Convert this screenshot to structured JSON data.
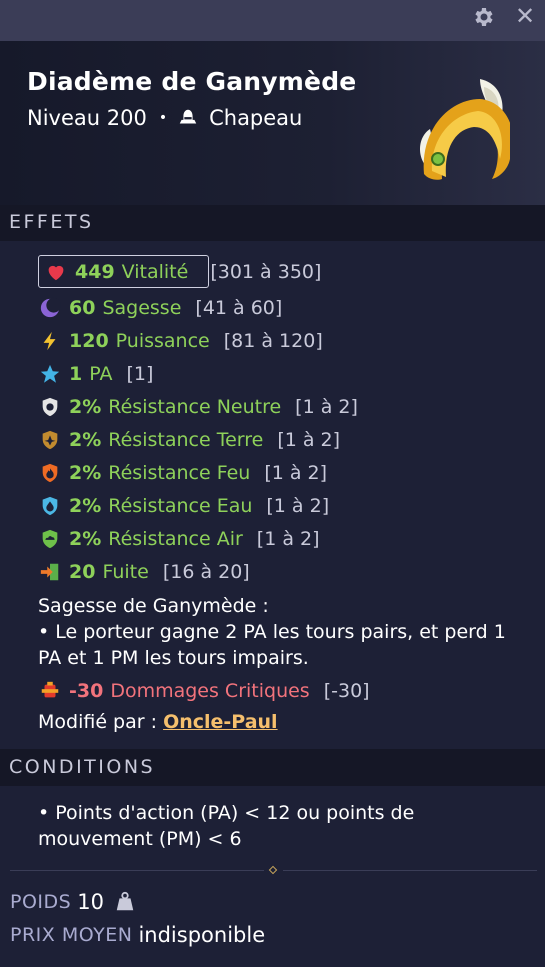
{
  "window": {
    "settings_icon": "gear-icon",
    "close_icon": "close-icon",
    "close_glyph": "✕"
  },
  "item": {
    "name": "Diadème de Ganymède",
    "level": "Niveau 200",
    "separator": "•",
    "type": "Chapeau",
    "type_icon": "hat-icon",
    "image": "tiara-icon"
  },
  "sections": {
    "effects": "EFFETS",
    "conditions": "CONDITIONS"
  },
  "effects": [
    {
      "icon": "heart-icon",
      "value": "449",
      "name": "Vitalité",
      "range": "[301 à 350]",
      "color": "#8ed15a"
    },
    {
      "icon": "moon-icon",
      "value": "60",
      "name": "Sagesse",
      "range": "[41 à 60]",
      "color": "#8ed15a"
    },
    {
      "icon": "lightning-icon",
      "value": "120",
      "name": "Puissance",
      "range": "[81 à 120]",
      "color": "#8ed15a"
    },
    {
      "icon": "star-icon",
      "value": "1",
      "name": "PA",
      "range": "[1]",
      "color": "#8ed15a"
    },
    {
      "icon": "neutral-resistance-icon",
      "value": "2%",
      "name": "Résistance Neutre",
      "range": "[1 à 2]",
      "color": "#8ed15a"
    },
    {
      "icon": "earth-resistance-icon",
      "value": "2%",
      "name": "Résistance Terre",
      "range": "[1 à 2]",
      "color": "#8ed15a"
    },
    {
      "icon": "fire-resistance-icon",
      "value": "2%",
      "name": "Résistance Feu",
      "range": "[1 à 2]",
      "color": "#8ed15a"
    },
    {
      "icon": "water-resistance-icon",
      "value": "2%",
      "name": "Résistance Eau",
      "range": "[1 à 2]",
      "color": "#8ed15a"
    },
    {
      "icon": "air-resistance-icon",
      "value": "2%",
      "name": "Résistance Air",
      "range": "[1 à 2]",
      "color": "#8ed15a"
    },
    {
      "icon": "flee-icon",
      "value": "20",
      "name": "Fuite",
      "range": "[16 à 20]",
      "color": "#8ed15a"
    }
  ],
  "special": {
    "title": "Sagesse de Ganymède :",
    "line1": "• Le porteur gagne 2 PA les tours pairs, et perd 1",
    "line2": "PA et 1 PM les tours impairs."
  },
  "negative_effect": {
    "icon": "critical-damage-icon",
    "value": "-30",
    "name": "Dommages Critiques",
    "range": "[-30]",
    "color": "#f2737c"
  },
  "modified_by": {
    "label": "Modifié par :",
    "name": "Oncle-Paul"
  },
  "conditions": {
    "line1": "• Points d'action (PA) < 12 ou points de",
    "line2": "mouvement (PM) < 6"
  },
  "meta": {
    "weight_label": "POIDS",
    "weight_value": "10",
    "weight_icon": "weight-icon",
    "price_label": "PRIX MOYEN",
    "price_value": "indisponible"
  }
}
